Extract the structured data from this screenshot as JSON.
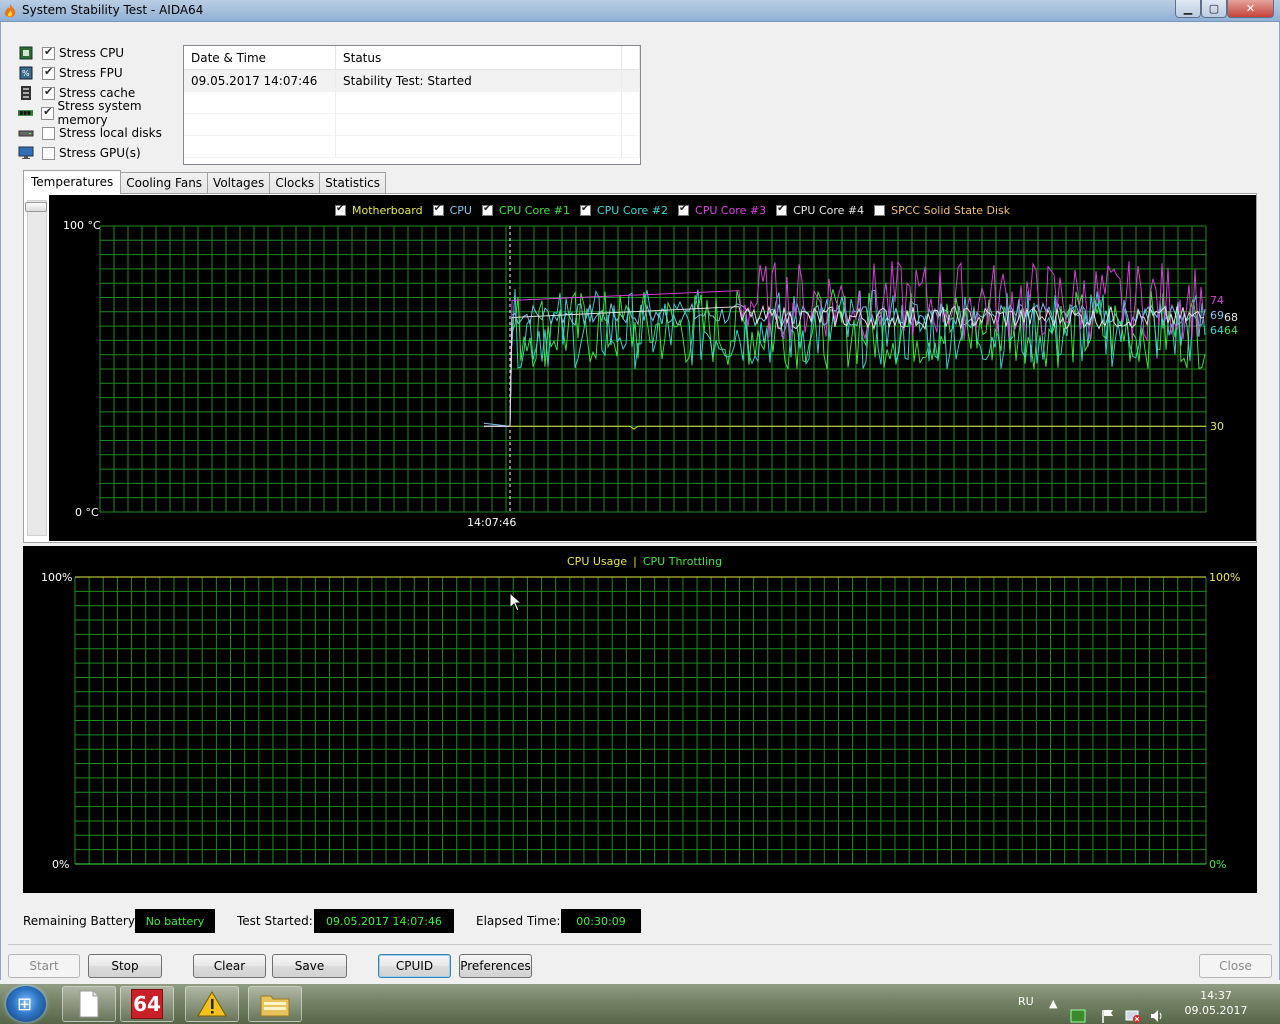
{
  "window": {
    "title": "System Stability Test - AIDA64",
    "min_glyph": "▁",
    "max_glyph": "▢",
    "close_glyph": "✕"
  },
  "stress": [
    {
      "label": "Stress CPU",
      "checked": true,
      "icon": "cpu-chip-icon"
    },
    {
      "label": "Stress FPU",
      "checked": true,
      "icon": "fpu-icon"
    },
    {
      "label": "Stress cache",
      "checked": true,
      "icon": "cache-icon"
    },
    {
      "label": "Stress system memory",
      "checked": true,
      "icon": "memory-module-icon"
    },
    {
      "label": "Stress local disks",
      "checked": false,
      "icon": "disk-drive-icon"
    },
    {
      "label": "Stress GPU(s)",
      "checked": false,
      "icon": "monitor-icon"
    }
  ],
  "log": {
    "headers": [
      "Date & Time",
      "Status"
    ],
    "rows": [
      {
        "datetime": "09.05.2017 14:07:46",
        "status": "Stability Test: Started"
      }
    ]
  },
  "tabs": [
    "Temperatures",
    "Cooling Fans",
    "Voltages",
    "Clocks",
    "Statistics"
  ],
  "active_tab": "Temperatures",
  "temp_legend": [
    {
      "label": "Motherboard",
      "checked": true,
      "color": "#e8e84a"
    },
    {
      "label": "CPU",
      "checked": true,
      "color": "#7ec8f0"
    },
    {
      "label": "CPU Core #1",
      "checked": true,
      "color": "#44e844"
    },
    {
      "label": "CPU Core #2",
      "checked": true,
      "color": "#3cd8d8"
    },
    {
      "label": "CPU Core #3",
      "checked": true,
      "color": "#e040e0"
    },
    {
      "label": "CPU Core #4",
      "checked": true,
      "color": "#e8e8e8"
    },
    {
      "label": "SPCC Solid State Disk",
      "checked": false,
      "color": "#f0c070"
    }
  ],
  "temp_axis": {
    "top": "100 °C",
    "bottom": "0 °C",
    "time_marker": "14:07:46"
  },
  "temp_values": {
    "core3": "74",
    "cpu": "69",
    "core4": "68",
    "core1": "64",
    "core2": "64",
    "motherboard": "30"
  },
  "usage_legend": {
    "usage": "CPU Usage",
    "separator": "|",
    "throttling": "CPU Throttling",
    "usage_color": "#e8e84a",
    "throttling_color": "#44e844"
  },
  "usage_axis": {
    "top_left": "100%",
    "bottom_left": "0%",
    "top_right": "100%",
    "bottom_right": "0%"
  },
  "status": {
    "battery_label": "Remaining Battery:",
    "battery_value": "No battery",
    "started_label": "Test Started:",
    "started_value": "09.05.2017 14:07:46",
    "elapsed_label": "Elapsed Time:",
    "elapsed_value": "00:30:09"
  },
  "buttons": {
    "start": "Start",
    "stop": "Stop",
    "clear": "Clear",
    "save": "Save",
    "cpuid": "CPUID",
    "preferences": "Preferences",
    "close": "Close"
  },
  "taskbar": {
    "aida_label": "64",
    "language": "RU",
    "time": "14:37",
    "date": "09.05.2017"
  },
  "chart_data": {
    "type": "line",
    "title": "",
    "ylabel": "°C",
    "ylim": [
      0,
      100
    ],
    "series": [
      {
        "name": "Motherboard",
        "values": [
          30,
          30,
          30,
          30
        ]
      },
      {
        "name": "CPU",
        "values": [
          30,
          69,
          69,
          69
        ]
      },
      {
        "name": "CPU Core #1",
        "values": [
          30,
          64,
          64,
          64
        ]
      },
      {
        "name": "CPU Core #2",
        "values": [
          30,
          64,
          64,
          64
        ]
      },
      {
        "name": "CPU Core #3",
        "values": [
          30,
          74,
          74,
          74
        ]
      },
      {
        "name": "CPU Core #4",
        "values": [
          30,
          68,
          68,
          68
        ]
      }
    ]
  }
}
